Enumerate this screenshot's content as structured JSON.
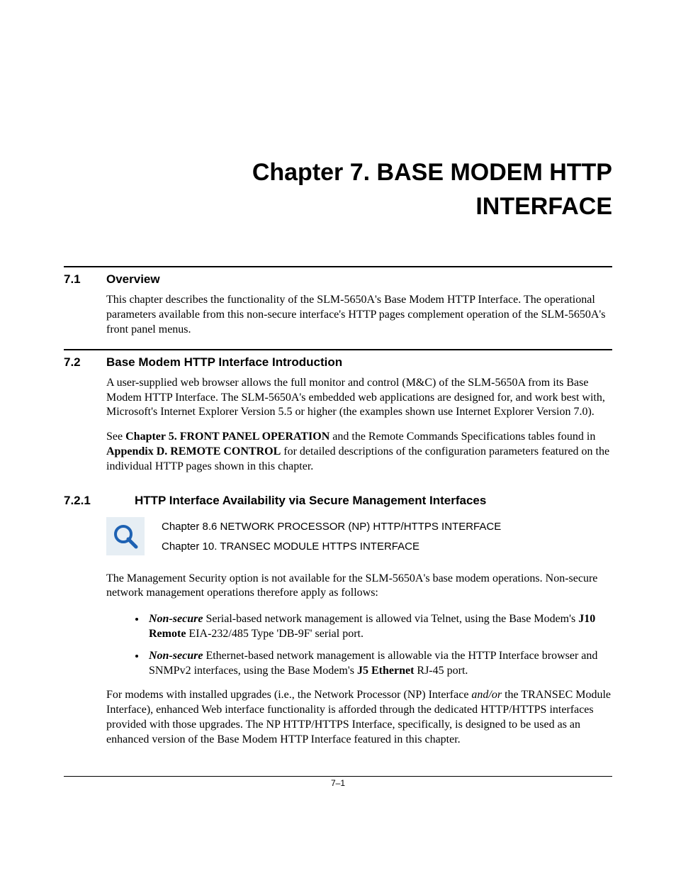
{
  "chapter": {
    "line1": "Chapter 7.  BASE MODEM HTTP",
    "line2": "INTERFACE"
  },
  "sections": {
    "s71": {
      "num": "7.1",
      "title": "Overview",
      "p1": "This chapter describes the functionality of the SLM-5650A's Base Modem HTTP Interface. The operational parameters available from this non-secure interface's HTTP pages complement operation of the SLM-5650A's front panel menus."
    },
    "s72": {
      "num": "7.2",
      "title": "Base Modem HTTP Interface Introduction",
      "p1": "A user-supplied web browser allows the full monitor and control (M&C) of the SLM-5650A from its Base Modem HTTP Interface. The SLM-5650A's embedded web applications are designed for, and work best with, Microsoft's Internet Explorer Version 5.5 or higher (the examples shown use Internet Explorer Version 7.0).",
      "p2_pre": "See ",
      "p2_b1": "Chapter 5. FRONT PANEL OPERATION",
      "p2_mid": " and the Remote Commands Specifications tables found in ",
      "p2_b2": "Appendix D. REMOTE CONTROL",
      "p2_post": " for detailed descriptions of the configuration parameters featured on the individual HTTP pages shown in this chapter."
    },
    "s721": {
      "num": "7.2.1",
      "title": "HTTP Interface Availability via Secure Management Interfaces",
      "note1": "Chapter 8.6 NETWORK PROCESSOR (NP) HTTP/HTTPS INTERFACE",
      "note2": "Chapter 10. TRANSEC MODULE HTTPS INTERFACE",
      "p1": "The Management Security option is not available for the SLM-5650A's base modem operations. Non-secure network management operations therefore apply as follows:",
      "bullets": [
        {
          "lead": "Non-secure",
          "t1": " Serial-based network management is allowed via Telnet, using the Base Modem's ",
          "b1": "J10 Remote",
          "t2": " EIA-232/485 Type 'DB-9F' serial port."
        },
        {
          "lead": "Non-secure",
          "t1": " Ethernet-based network management is allowable via the HTTP Interface browser and SNMPv2 interfaces, using the Base Modem's ",
          "b1": "J5 Ethernet",
          "t2": " RJ-45 port."
        }
      ],
      "p2_pre": "For modems with installed upgrades (i.e., the Network Processor (NP) Interface ",
      "p2_i": "and/or",
      "p2_post": " the TRANSEC Module Interface), enhanced Web interface functionality is afforded through the dedicated HTTP/HTTPS interfaces provided with those upgrades. The NP HTTP/HTTPS Interface, specifically, is designed to be used as an enhanced version of the Base Modem HTTP Interface featured in this chapter."
    }
  },
  "page_number": "7–1"
}
